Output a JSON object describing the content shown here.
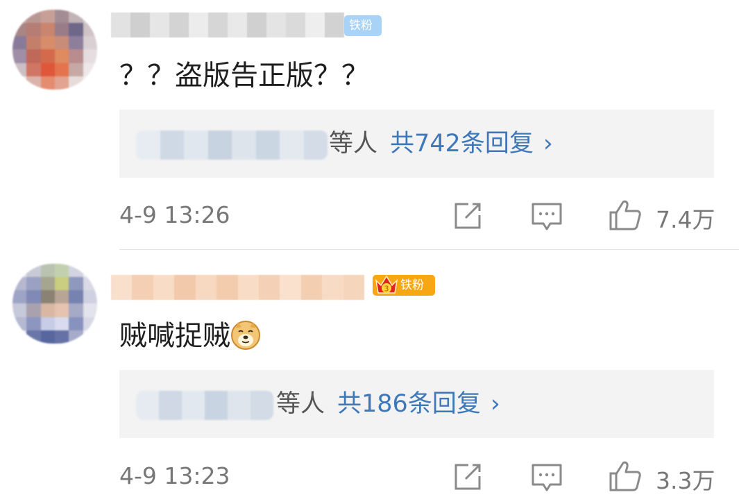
{
  "comments": [
    {
      "badge": "铁粉",
      "text": "？？盗版告正版？？",
      "reply_suffix": "等人",
      "reply_count": "共742条回复",
      "reply_chevron": "›",
      "time": "4-9 13:26",
      "likes": "7.4万",
      "badge_color": "#a8d2f6"
    },
    {
      "badge": "铁粉",
      "text": "贼喊捉贼",
      "emoji": "doge-emoji",
      "reply_suffix": "等人",
      "reply_count": "共186条回复",
      "reply_chevron": "›",
      "time": "4-9 13:23",
      "likes": "3.3万",
      "badge_color": "#f7a712"
    }
  ],
  "colors": {
    "link": "#3f78b8",
    "meta": "#777777",
    "reply_bg": "#f3f3f3"
  },
  "icons": [
    "share-icon",
    "comment-icon",
    "like-icon",
    "crown-icon"
  ]
}
